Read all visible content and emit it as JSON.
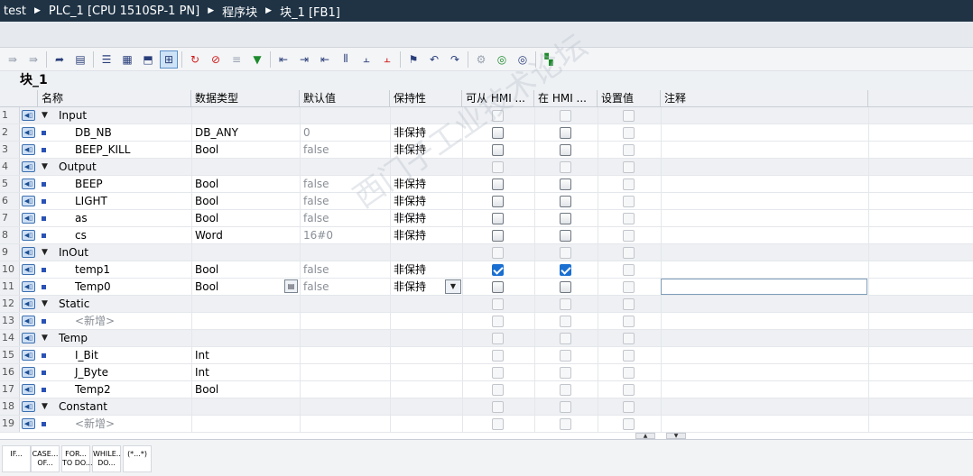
{
  "breadcrumb": [
    "test",
    "PLC_1 [CPU 1510SP-1 PN]",
    "程序块",
    "块_1 [FB1]"
  ],
  "block_title": "块_1",
  "columns": [
    "名称",
    "数据类型",
    "默认值",
    "保持性",
    "可从 HMI ...",
    "在 HMI ...",
    "设置值",
    "注释"
  ],
  "rows": [
    {
      "n": "1",
      "name": "Input",
      "section": true
    },
    {
      "n": "2",
      "name": "DB_NB",
      "type": "DB_ANY",
      "default": "0",
      "retain": "非保持",
      "hmi1": false,
      "hmi2": false
    },
    {
      "n": "3",
      "name": "BEEP_KILL",
      "type": "Bool",
      "default": "false",
      "retain": "非保持",
      "hmi1": false,
      "hmi2": false
    },
    {
      "n": "4",
      "name": "Output",
      "section": true
    },
    {
      "n": "5",
      "name": "BEEP",
      "type": "Bool",
      "default": "false",
      "retain": "非保持",
      "hmi1": false,
      "hmi2": false
    },
    {
      "n": "6",
      "name": "LIGHT",
      "type": "Bool",
      "default": "false",
      "retain": "非保持",
      "hmi1": false,
      "hmi2": false
    },
    {
      "n": "7",
      "name": "as",
      "type": "Bool",
      "default": "false",
      "retain": "非保持",
      "hmi1": false,
      "hmi2": false
    },
    {
      "n": "8",
      "name": "cs",
      "type": "Word",
      "default": "16#0",
      "retain": "非保持",
      "hmi1": false,
      "hmi2": false
    },
    {
      "n": "9",
      "name": "InOut",
      "section": true
    },
    {
      "n": "10",
      "name": "temp1",
      "type": "Bool",
      "default": "false",
      "retain": "非保持",
      "hmi1": true,
      "hmi2": true
    },
    {
      "n": "11",
      "name": "Temp0",
      "type": "Bool",
      "default": "false",
      "retain": "非保持",
      "hmi1": false,
      "hmi2": false,
      "focus": true
    },
    {
      "n": "12",
      "name": "Static",
      "section": true
    },
    {
      "n": "13",
      "name": "<新增>",
      "add": true
    },
    {
      "n": "14",
      "name": "Temp",
      "section": true
    },
    {
      "n": "15",
      "name": "I_Bit",
      "type": "Int",
      "temp": true
    },
    {
      "n": "16",
      "name": "J_Byte",
      "type": "Int",
      "temp": true
    },
    {
      "n": "17",
      "name": "Temp2",
      "type": "Bool",
      "temp": true
    },
    {
      "n": "18",
      "name": "Constant",
      "section": true
    },
    {
      "n": "19",
      "name": "<新增>",
      "add": true
    }
  ],
  "snippets": [
    "IF...",
    "CASE...\nOF...",
    "FOR...\nTO DO...",
    "WHILE..\nDO...",
    "(*...*)"
  ],
  "watermark": "西门子工业技术论坛"
}
